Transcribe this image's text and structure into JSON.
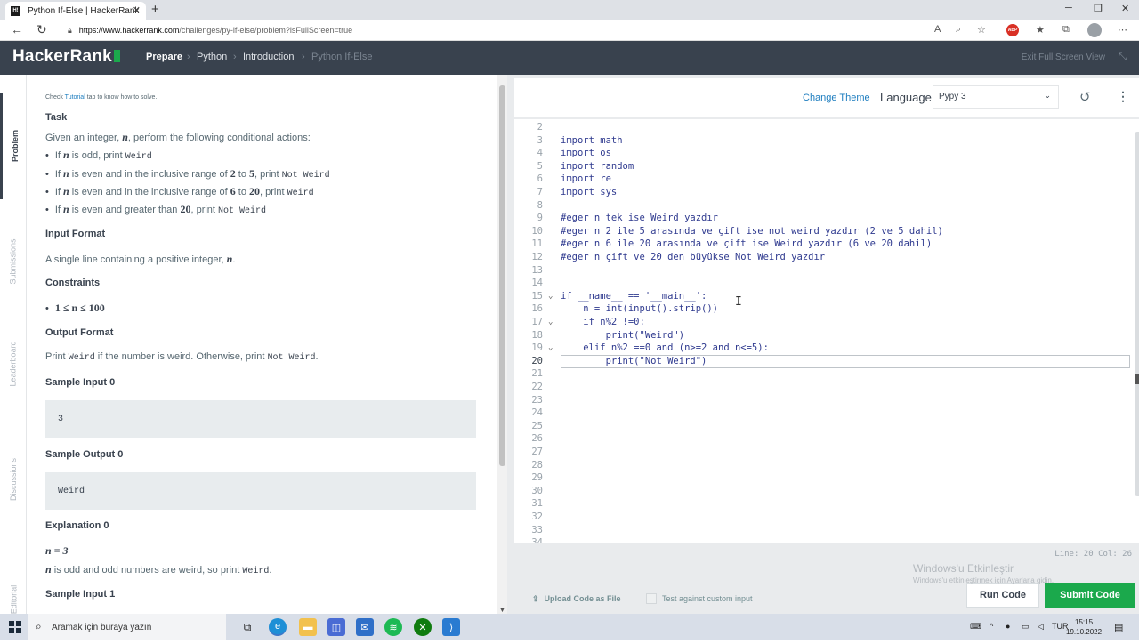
{
  "browser": {
    "tab_title": "Python If-Else | HackerRank",
    "favicon_text": "H!",
    "url_host": "https://www.hackerrank.com",
    "url_path": "/challenges/py-if-else/problem?isFullScreen=true"
  },
  "header": {
    "logo": "HackerRank",
    "breadcrumbs": [
      "Prepare",
      "Python",
      "Introduction",
      "Python If-Else"
    ],
    "exit_label": "Exit Full Screen View"
  },
  "side_tabs": [
    "Problem",
    "Submissions",
    "Leaderboard",
    "Discussions",
    "Editorial"
  ],
  "problem": {
    "hint_pre": "Check ",
    "hint_link": "Tutorial",
    "hint_post": " tab to know how to solve.",
    "task_heading": "Task",
    "task_intro_a": "Given an integer, ",
    "task_intro_b": ", perform the following conditional actions:",
    "var_n": "n",
    "rules": [
      {
        "pre": "If ",
        "mid": " is odd, print ",
        "code": "Weird"
      },
      {
        "pre": "If ",
        "mid": " is even and in the inclusive range of ",
        "a": "2",
        "to": " to ",
        "b": "5",
        "post": ", print ",
        "code": "Not Weird"
      },
      {
        "pre": "If ",
        "mid": " is even and in the inclusive range of ",
        "a": "6",
        "to": " to ",
        "b": "20",
        "post": ", print ",
        "code": "Weird"
      },
      {
        "pre": "If ",
        "mid": " is even and greater than ",
        "a": "20",
        "post": ", print ",
        "code": "Not Weird"
      }
    ],
    "input_heading": "Input Format",
    "input_text": "A single line containing a positive integer, ",
    "input_end": ".",
    "constraints_heading": "Constraints",
    "constraint": "1 ≤ n ≤ 100",
    "output_heading": "Output Format",
    "output_pre": "Print ",
    "output_code1": "Weird",
    "output_mid": " if the number is weird. Otherwise, print ",
    "output_code2": "Not Weird",
    "output_end": ".",
    "sample_input0_heading": "Sample Input 0",
    "sample_input0": "3",
    "sample_output0_heading": "Sample Output 0",
    "sample_output0": "Weird",
    "explanation0_heading": "Explanation 0",
    "explanation0_eq": "n = 3",
    "explanation0_pre": " is odd and odd numbers are weird, so print ",
    "explanation0_code": "Weird",
    "explanation0_end": ".",
    "sample_input1_heading": "Sample Input 1"
  },
  "editor": {
    "change_theme": "Change Theme",
    "language_label": "Language",
    "language_value": "Pypy 3",
    "status": "Line: 20 Col: 26",
    "active_line": 20,
    "lines": [
      {
        "n": "2",
        "text": ""
      },
      {
        "n": "3",
        "text": "import math"
      },
      {
        "n": "4",
        "text": "import os"
      },
      {
        "n": "5",
        "text": "import random"
      },
      {
        "n": "6",
        "text": "import re"
      },
      {
        "n": "7",
        "text": "import sys"
      },
      {
        "n": "8",
        "text": ""
      },
      {
        "n": "9",
        "text": "#eger n tek ise Weird yazdır"
      },
      {
        "n": "10",
        "text": "#eger n 2 ile 5 arasında ve çift ise not weird yazdır (2 ve 5 dahil)"
      },
      {
        "n": "11",
        "text": "#eger n 6 ile 20 arasında ve çift ise Weird yazdır (6 ve 20 dahil)"
      },
      {
        "n": "12",
        "text": "#eger n çift ve 20 den büyükse Not Weird yazdır"
      },
      {
        "n": "13",
        "text": ""
      },
      {
        "n": "14",
        "text": ""
      },
      {
        "n": "15",
        "text": "if __name__ == '__main__':",
        "fold": true
      },
      {
        "n": "16",
        "text": "    n = int(input().strip())"
      },
      {
        "n": "17",
        "text": "    if n%2 !=0:",
        "fold": true
      },
      {
        "n": "18",
        "text": "        print(\"Weird\")"
      },
      {
        "n": "19",
        "text": "    elif n%2 ==0 and (n>=2 and n<=5):",
        "fold": true
      },
      {
        "n": "20",
        "text": "        print(\"Not Weird\")"
      },
      {
        "n": "21",
        "text": ""
      },
      {
        "n": "22",
        "text": ""
      },
      {
        "n": "23",
        "text": ""
      },
      {
        "n": "24",
        "text": ""
      },
      {
        "n": "25",
        "text": ""
      },
      {
        "n": "26",
        "text": ""
      },
      {
        "n": "27",
        "text": ""
      },
      {
        "n": "28",
        "text": ""
      },
      {
        "n": "29",
        "text": ""
      },
      {
        "n": "30",
        "text": ""
      },
      {
        "n": "31",
        "text": ""
      },
      {
        "n": "32",
        "text": ""
      },
      {
        "n": "33",
        "text": ""
      },
      {
        "n": "34",
        "text": ""
      }
    ],
    "upload_label": "Upload Code as File",
    "custom_input_label": "Test against custom input",
    "run_label": "Run Code",
    "submit_label": "Submit Code"
  },
  "watermark": {
    "title": "Windows'u Etkinleştir",
    "sub": "Windows'u etkinleştirmek için Ayarlar'a gidin."
  },
  "taskbar": {
    "search_placeholder": "Aramak için buraya yazın",
    "lang": "TUR",
    "time": "15:15",
    "date": "19.10.2022"
  },
  "colors": {
    "header_bg": "#39424e",
    "brand_green": "#1ba94c",
    "link_blue": "#1d7dbf"
  }
}
